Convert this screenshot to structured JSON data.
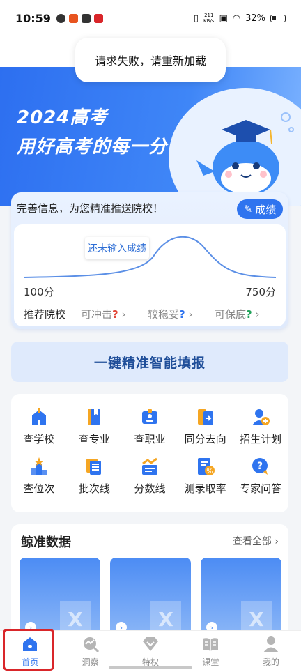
{
  "status_bar": {
    "time": "10:59",
    "speed_top": "211",
    "speed_unit": "KB/s",
    "battery": "32%"
  },
  "toast": "请求失败，请重新加载",
  "hero": {
    "line1": "2024高考",
    "line2": "用好高考的每一分"
  },
  "score_card": {
    "prompt": "完善信息，为您精准推送院校！",
    "grade_button": "成绩",
    "tooltip": "还未输入成绩",
    "min_label": "100分",
    "max_label": "750分",
    "recommend_label": "推荐院校",
    "options": [
      {
        "label": "可冲击",
        "q": "?",
        "color": "#e24a3b"
      },
      {
        "label": "较稳妥",
        "q": "?",
        "color": "#2f74ef"
      },
      {
        "label": "可保底",
        "q": "?",
        "color": "#23a35b"
      }
    ]
  },
  "smart_fill": "一键精准智能填报",
  "features": [
    {
      "label": "查学校",
      "icon": "school-icon"
    },
    {
      "label": "查专业",
      "icon": "book-icon"
    },
    {
      "label": "查职业",
      "icon": "badge-icon"
    },
    {
      "label": "同分去向",
      "icon": "transfer-icon"
    },
    {
      "label": "招生计划",
      "icon": "person-add-icon"
    },
    {
      "label": "查位次",
      "icon": "podium-icon"
    },
    {
      "label": "批次线",
      "icon": "list-icon"
    },
    {
      "label": "分数线",
      "icon": "chart-icon"
    },
    {
      "label": "测录取率",
      "icon": "percent-icon"
    },
    {
      "label": "专家问答",
      "icon": "question-icon"
    }
  ],
  "data_section": {
    "title": "鲸准数据",
    "view_all": "查看全部"
  },
  "tabs": [
    {
      "label": "首页",
      "icon": "home-icon"
    },
    {
      "label": "洞察",
      "icon": "insight-icon"
    },
    {
      "label": "特权",
      "icon": "diamond-icon"
    },
    {
      "label": "课堂",
      "icon": "classroom-icon"
    },
    {
      "label": "我的",
      "icon": "profile-icon"
    }
  ],
  "colors": {
    "primary": "#2f74ef",
    "hero_start": "#2d6ff0",
    "highlight_box": "#d9262a"
  }
}
